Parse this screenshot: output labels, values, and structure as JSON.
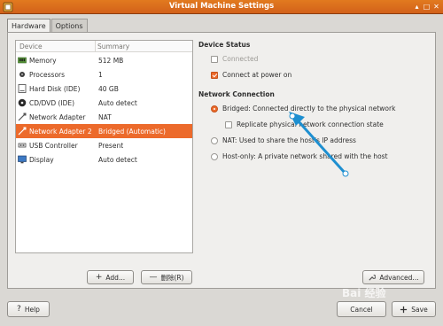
{
  "window": {
    "title": "Virtual Machine Settings",
    "controls": {
      "up": "▴",
      "maximize": "□",
      "close": "✕"
    }
  },
  "tabs": [
    {
      "label": "Hardware",
      "active": true
    },
    {
      "label": "Options",
      "active": false
    }
  ],
  "device_list": {
    "headers": {
      "device": "Device",
      "summary": "Summary"
    },
    "rows": [
      {
        "icon": "memory-icon",
        "device": "Memory",
        "summary": "512 MB",
        "selected": false
      },
      {
        "icon": "processor-icon",
        "device": "Processors",
        "summary": "1",
        "selected": false
      },
      {
        "icon": "hard-disk-icon",
        "device": "Hard Disk (IDE)",
        "summary": "40 GB",
        "selected": false
      },
      {
        "icon": "cd-dvd-icon",
        "device": "CD/DVD (IDE)",
        "summary": "Auto detect",
        "selected": false
      },
      {
        "icon": "network-adapter-icon",
        "device": "Network Adapter",
        "summary": "NAT",
        "selected": false
      },
      {
        "icon": "network-adapter-icon",
        "device": "Network Adapter 2",
        "summary": "Bridged (Automatic)",
        "selected": true
      },
      {
        "icon": "usb-icon",
        "device": "USB Controller",
        "summary": "Present",
        "selected": false
      },
      {
        "icon": "display-icon",
        "device": "Display",
        "summary": "Auto detect",
        "selected": false
      }
    ]
  },
  "buttons": {
    "add": "Add...",
    "add_glyph": "+",
    "remove": "删除(R)",
    "remove_glyph": "—",
    "advanced": "Advanced...",
    "help": "Help",
    "help_glyph": "?",
    "cancel": "Cancel",
    "save": "Save"
  },
  "device_status": {
    "title": "Device Status",
    "connected": {
      "label": "Connected",
      "checked": false,
      "enabled": false
    },
    "connect_at_power_on": {
      "label": "Connect at power on",
      "checked": true
    }
  },
  "network_connection": {
    "title": "Network Connection",
    "bridged": {
      "label": "Bridged: Connected directly to the physical network",
      "selected": true
    },
    "replicate": {
      "label": "Replicate physical network connection state",
      "checked": false
    },
    "nat": {
      "label": "NAT: Used to share the host's IP address",
      "selected": false
    },
    "host_only": {
      "label": "Host-only: A private network shared with the host",
      "selected": false
    }
  },
  "watermark": "Bai 经验",
  "colors": {
    "accent": "#ec6a2b",
    "title_bar": "#dc6d1d",
    "annotation_arrow": "#1e8fd0"
  }
}
